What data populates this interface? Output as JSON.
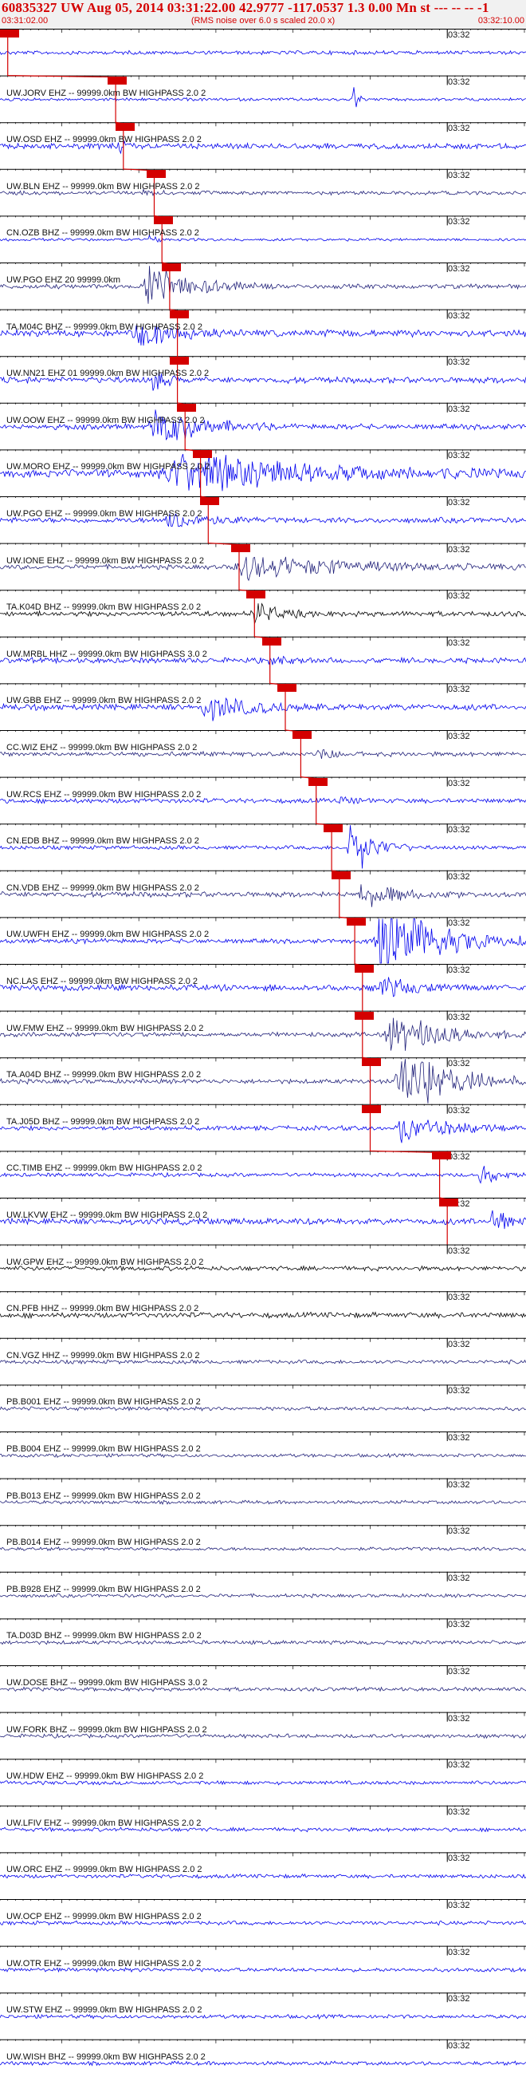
{
  "header": {
    "title": "60835327 UW Aug 05, 2014 03:31:22.00   42.9777 -117.0537  1.3 0.00 Mn st --- -- --  -1",
    "start_time": "03:31:02.00",
    "note": "(RMS noise over 6.0 s scaled 20.0 x)",
    "end_time": "03:32:10.00"
  },
  "tick_label": "03:32",
  "colors": {
    "accent": "#d40000",
    "blue": "#0000ee",
    "navy": "#22227a",
    "black": "#000000",
    "header_bg": "#f1f1f1"
  },
  "stations": [
    {
      "label": "",
      "pick": "03:31:03",
      "color": "#0000ee",
      "amp": 0.5,
      "burst": 0.0,
      "bstart": 0.0,
      "bdur": 0.05
    },
    {
      "label": "UW.JORV EHZ -- 99999.0km BW  HIGHPASS  2.0  2",
      "pick": "03:31:17",
      "color": "#0000ee",
      "amp": 0.4,
      "burst": 3.5,
      "bstart": 0.67,
      "bdur": 0.02
    },
    {
      "label": "UW.OSD EHZ -- 99999.0km BW  HIGHPASS  2.0  2",
      "pick": "03:31:18",
      "color": "#0000ee",
      "amp": 0.7,
      "burst": 1.5,
      "bstart": 0.22,
      "bdur": 0.04
    },
    {
      "label": "UW.BLN EHZ -- 99999.0km BW  HIGHPASS  2.0  2",
      "pick": "03:31:22",
      "color": "#22227a",
      "amp": 0.5,
      "burst": 0.6,
      "bstart": 0.27,
      "bdur": 0.05
    },
    {
      "label": "CN.OZB BHZ -- 99999.0km BW  HIGHPASS  2.0  2",
      "pick": "03:31:23",
      "color": "#0000ee",
      "amp": 0.35,
      "burst": 0.8,
      "bstart": 0.28,
      "bdur": 0.04
    },
    {
      "label": "UW.PGO EHZ 20 99999.0km",
      "pick": "03:31:24",
      "color": "#22227a",
      "amp": 0.6,
      "burst": 2.2,
      "bstart": 0.27,
      "bdur": 0.25
    },
    {
      "label": "TA.M04C BHZ -- 99999.0km BW  HIGHPASS  2.0  2",
      "pick": "03:31:25",
      "color": "#0000ee",
      "amp": 0.9,
      "burst": 1.4,
      "bstart": 0.25,
      "bdur": 0.2
    },
    {
      "label": "UW.NN21 EHZ 01 99999.0km BW  HIGHPASS  2.0  2",
      "pick": "03:31:25",
      "color": "#0000ee",
      "amp": 0.8,
      "burst": 2.0,
      "bstart": 0.29,
      "bdur": 0.05
    },
    {
      "label": "UW.OOW EHZ -- 99999.0km BW  HIGHPASS  2.0  2",
      "pick": "03:31:26",
      "color": "#0000ee",
      "amp": 0.7,
      "burst": 2.4,
      "bstart": 0.28,
      "bdur": 0.25
    },
    {
      "label": "UW.MORO EHZ -- 99999.0km BW  HIGHPASS  2.0  2",
      "pick": "03:31:28",
      "color": "#0000ee",
      "amp": 1.0,
      "burst": 2.2,
      "bstart": 0.3,
      "bdur": 0.7
    },
    {
      "label": "UW.PGO EHZ -- 99999.0km BW  HIGHPASS  2.0  2",
      "pick": "03:31:29",
      "color": "#0000ee",
      "amp": 0.7,
      "burst": 1.2,
      "bstart": 0.31,
      "bdur": 0.2
    },
    {
      "label": "UW.IONE EHZ -- 99999.0km BW  HIGHPASS  2.0  2",
      "pick": "03:31:33",
      "color": "#22227a",
      "amp": 0.6,
      "burst": 1.5,
      "bstart": 0.44,
      "bdur": 0.56
    },
    {
      "label": "TA.K04D BHZ -- 99999.0km BW  HIGHPASS  2.0  2",
      "pick": "03:31:35",
      "color": "#000000",
      "amp": 0.7,
      "burst": 1.5,
      "bstart": 0.48,
      "bdur": 0.12
    },
    {
      "label": "UW.MRBL HHZ -- 99999.0km BW  HIGHPASS  3.0  2",
      "pick": "03:31:37",
      "color": "#0000ee",
      "amp": 0.7,
      "burst": 0.6,
      "bstart": 0.5,
      "bdur": 0.1
    },
    {
      "label": "UW.GBB EHZ -- 99999.0km BW  HIGHPASS  2.0  2",
      "pick": "03:31:39",
      "color": "#0000ee",
      "amp": 0.8,
      "burst": 1.4,
      "bstart": 0.38,
      "bdur": 0.25
    },
    {
      "label": "CC.WIZ EHZ -- 99999.0km BW  HIGHPASS  2.0  2",
      "pick": "03:31:41",
      "color": "#22227a",
      "amp": 0.6,
      "burst": 0.6,
      "bstart": 0.6,
      "bdur": 0.1
    },
    {
      "label": "UW.RCS EHZ -- 99999.0km BW  HIGHPASS  2.0  2",
      "pick": "03:31:43",
      "color": "#0000ee",
      "amp": 0.6,
      "burst": 0.4,
      "bstart": 0.64,
      "bdur": 0.1
    },
    {
      "label": "CN.EDB BHZ -- 99999.0km BW  HIGHPASS  2.0  2",
      "pick": "03:31:45",
      "color": "#0000ee",
      "amp": 0.5,
      "burst": 3.5,
      "bstart": 0.66,
      "bdur": 0.12
    },
    {
      "label": "CN.VDB EHZ -- 99999.0km BW  HIGHPASS  2.0  2",
      "pick": "03:31:46",
      "color": "#22227a",
      "amp": 0.7,
      "burst": 1.4,
      "bstart": 0.68,
      "bdur": 0.2
    },
    {
      "label": "UW.UWFH EHZ -- 99999.0km BW  HIGHPASS  2.0  2",
      "pick": "03:31:48",
      "color": "#0000ee",
      "amp": 0.6,
      "burst": 5.0,
      "bstart": 0.71,
      "bdur": 0.29
    },
    {
      "label": "NC.LAS EHZ -- 99999.0km BW  HIGHPASS  2.0  2",
      "pick": "03:31:49",
      "color": "#0000ee",
      "amp": 0.8,
      "burst": 1.3,
      "bstart": 0.72,
      "bdur": 0.15
    },
    {
      "label": "UW.FMW EHZ -- 99999.0km BW  HIGHPASS  2.0  2",
      "pick": "03:31:49",
      "color": "#22227a",
      "amp": 0.6,
      "burst": 2.6,
      "bstart": 0.73,
      "bdur": 0.27
    },
    {
      "label": "TA.A04D BHZ -- 99999.0km BW  HIGHPASS  2.0  2",
      "pick": "03:31:50",
      "color": "#22227a",
      "amp": 0.6,
      "burst": 4.5,
      "bstart": 0.75,
      "bdur": 0.25
    },
    {
      "label": "TA.J05D BHZ -- 99999.0km BW  HIGHPASS  2.0  2",
      "pick": "03:31:50",
      "color": "#0000ee",
      "amp": 0.6,
      "burst": 1.6,
      "bstart": 0.75,
      "bdur": 0.25
    },
    {
      "label": "CC.TIMB EHZ -- 99999.0km BW  HIGHPASS  2.0  2",
      "pick": "03:31:59",
      "color": "#0000ee",
      "amp": 0.5,
      "burst": 1.5,
      "bstart": 0.91,
      "bdur": 0.08
    },
    {
      "label": "UW.LKVW EHZ -- 99999.0km BW  HIGHPASS  2.0  2",
      "pick": "03:32:00",
      "color": "#0000ee",
      "amp": 0.8,
      "burst": 2.2,
      "bstart": 0.93,
      "bdur": 0.07
    },
    {
      "label": "UW.GPW EHZ -- 99999.0km BW  HIGHPASS  2.0  2",
      "pick": "",
      "color": "#000000",
      "amp": 0.6,
      "burst": 0.0,
      "bstart": 0.0,
      "bdur": 0.05
    },
    {
      "label": "CN.PFB HHZ -- 99999.0km BW  HIGHPASS  2.0  2",
      "pick": "",
      "color": "#000000",
      "amp": 0.7,
      "burst": 0.0,
      "bstart": 0.0,
      "bdur": 0.05
    },
    {
      "label": "CN.VGZ HHZ -- 99999.0km BW  HIGHPASS  2.0  2",
      "pick": "",
      "color": "#22227a",
      "amp": 0.5,
      "burst": 0.0,
      "bstart": 0.0,
      "bdur": 0.05
    },
    {
      "label": "PB.B001 EHZ -- 99999.0km BW  HIGHPASS  2.0  2",
      "pick": "",
      "color": "#22227a",
      "amp": 0.5,
      "burst": 0.0,
      "bstart": 0.0,
      "bdur": 0.05
    },
    {
      "label": "PB.B004 EHZ -- 99999.0km BW  HIGHPASS  2.0  2",
      "pick": "",
      "color": "#22227a",
      "amp": 0.45,
      "burst": 0.0,
      "bstart": 0.0,
      "bdur": 0.05
    },
    {
      "label": "PB.B013 EHZ -- 99999.0km BW  HIGHPASS  2.0  2",
      "pick": "",
      "color": "#22227a",
      "amp": 0.45,
      "burst": 0.0,
      "bstart": 0.0,
      "bdur": 0.05
    },
    {
      "label": "PB.B014 EHZ -- 99999.0km BW  HIGHPASS  2.0  2",
      "pick": "",
      "color": "#22227a",
      "amp": 0.45,
      "burst": 0.0,
      "bstart": 0.0,
      "bdur": 0.05
    },
    {
      "label": "PB.B928 EHZ -- 99999.0km BW  HIGHPASS  2.0  2",
      "pick": "",
      "color": "#22227a",
      "amp": 0.45,
      "burst": 0.0,
      "bstart": 0.0,
      "bdur": 0.05
    },
    {
      "label": "TA.D03D BHZ -- 99999.0km BW  HIGHPASS  2.0  2",
      "pick": "",
      "color": "#22227a",
      "amp": 0.5,
      "burst": 0.0,
      "bstart": 0.0,
      "bdur": 0.05
    },
    {
      "label": "UW.DOSE BHZ -- 99999.0km BW  HIGHPASS  3.0  2",
      "pick": "",
      "color": "#22227a",
      "amp": 0.5,
      "burst": 0.0,
      "bstart": 0.0,
      "bdur": 0.05
    },
    {
      "label": "UW.FORK BHZ -- 99999.0km BW  HIGHPASS  2.0  2",
      "pick": "",
      "color": "#22227a",
      "amp": 0.5,
      "burst": 0.0,
      "bstart": 0.0,
      "bdur": 0.05
    },
    {
      "label": "UW.HDW EHZ -- 99999.0km BW  HIGHPASS  2.0  2",
      "pick": "",
      "color": "#0000ee",
      "amp": 0.5,
      "burst": 0.0,
      "bstart": 0.0,
      "bdur": 0.05
    },
    {
      "label": "UW.LFIV EHZ -- 99999.0km BW  HIGHPASS  2.0  2",
      "pick": "",
      "color": "#0000ee",
      "amp": 0.5,
      "burst": 0.0,
      "bstart": 0.0,
      "bdur": 0.05
    },
    {
      "label": "UW.ORC EHZ -- 99999.0km BW  HIGHPASS  2.0  2",
      "pick": "",
      "color": "#0000ee",
      "amp": 0.5,
      "burst": 0.0,
      "bstart": 0.0,
      "bdur": 0.05
    },
    {
      "label": "UW.OCP EHZ -- 99999.0km BW  HIGHPASS  2.0  2",
      "pick": "",
      "color": "#0000ee",
      "amp": 0.5,
      "burst": 0.0,
      "bstart": 0.0,
      "bdur": 0.05
    },
    {
      "label": "UW.OTR EHZ -- 99999.0km BW  HIGHPASS  2.0  2",
      "pick": "",
      "color": "#0000ee",
      "amp": 0.5,
      "burst": 0.0,
      "bstart": 0.0,
      "bdur": 0.05
    },
    {
      "label": "UW.STW EHZ -- 99999.0km BW  HIGHPASS  2.0  2",
      "pick": "",
      "color": "#0000ee",
      "amp": 0.5,
      "burst": 0.0,
      "bstart": 0.0,
      "bdur": 0.05
    },
    {
      "label": "UW.WISH BHZ -- 99999.0km BW  HIGHPASS  2.0  2",
      "pick": "",
      "color": "#0000ee",
      "amp": 0.5,
      "burst": 0.0,
      "bstart": 0.0,
      "bdur": 0.05
    }
  ]
}
